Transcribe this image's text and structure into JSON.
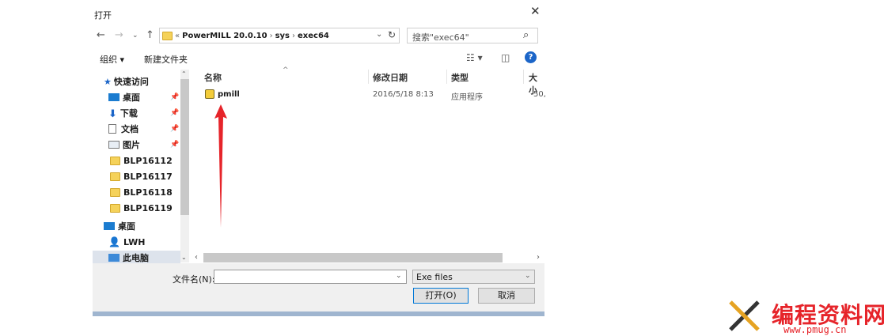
{
  "window": {
    "title": "打开"
  },
  "address_bar": {
    "prefix": "«",
    "segments": [
      "PowerMILL 20.0.10",
      "sys",
      "exec64"
    ]
  },
  "search": {
    "placeholder": "搜索\"exec64\""
  },
  "toolbar": {
    "organize_label": "组织 ▾",
    "new_folder_label": "新建文件夹",
    "help_label": "?"
  },
  "nav": {
    "quick_access_label": "快速访问",
    "items": [
      {
        "label": "桌面"
      },
      {
        "label": "下载"
      },
      {
        "label": "文档"
      },
      {
        "label": "图片"
      },
      {
        "label": "BLP16112"
      },
      {
        "label": "BLP16117"
      },
      {
        "label": "BLP16118"
      },
      {
        "label": "BLP16119"
      },
      {
        "label": "桌面"
      },
      {
        "label": "LWH"
      },
      {
        "label": "此电脑"
      }
    ]
  },
  "columns": [
    "名称",
    "修改日期",
    "类型",
    "大小"
  ],
  "files": [
    {
      "name": "pmill",
      "date": "2016/5/18 8:13",
      "type": "应用程序",
      "size": "50,"
    }
  ],
  "filename": {
    "label": "文件名(N):",
    "value": ""
  },
  "filetype": {
    "selected": "Exe files"
  },
  "buttons": {
    "open": "打开(O)",
    "cancel": "取消"
  },
  "watermark": {
    "text": "编程资料网",
    "url": "www.pmug.cn"
  },
  "colors": {
    "accent": "#1b65c8",
    "arrow": "#e6242a",
    "selection": "#dde3ec"
  }
}
